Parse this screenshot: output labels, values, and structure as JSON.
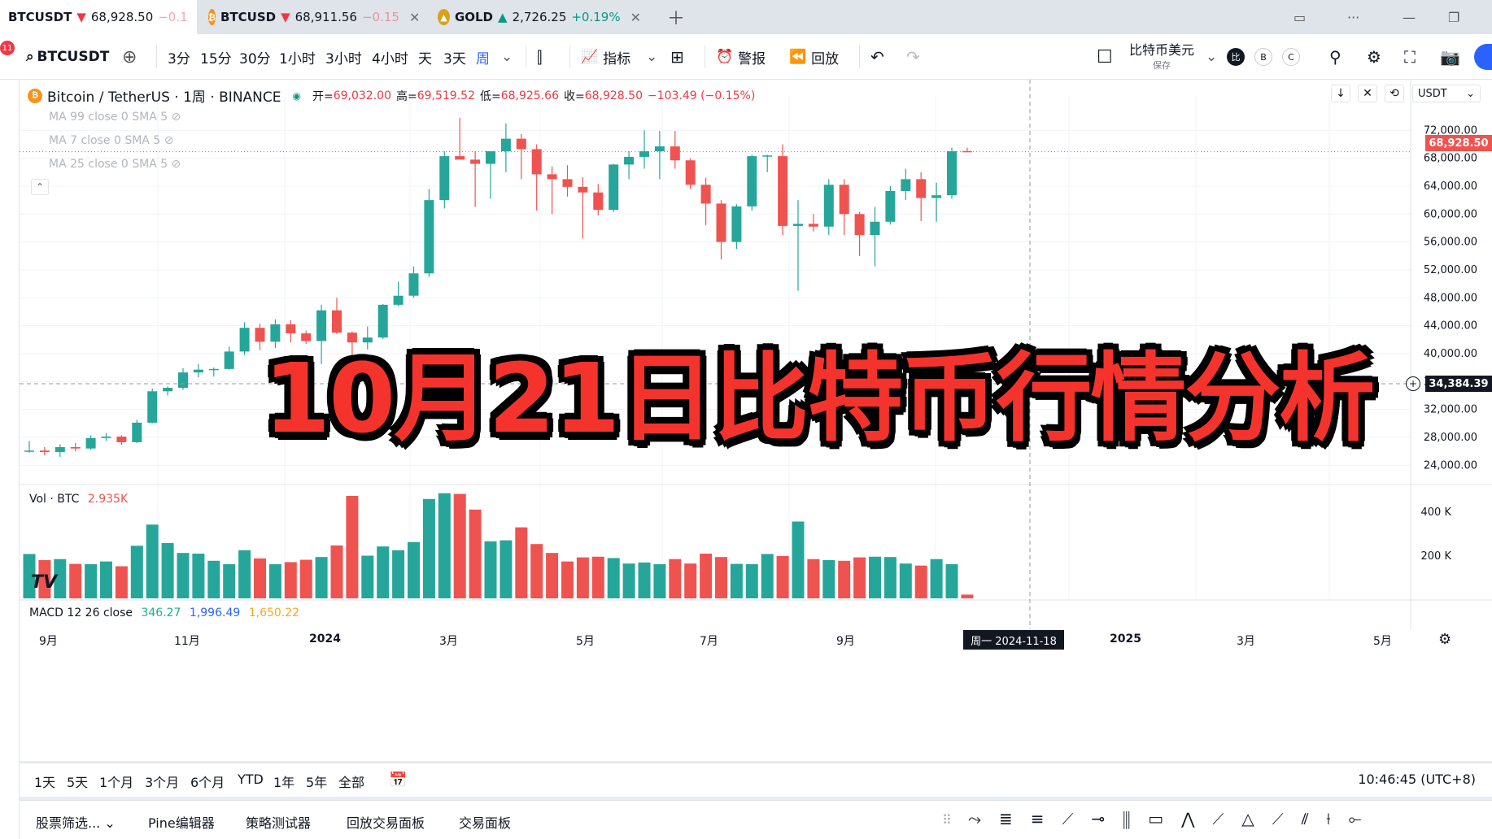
{
  "tabs": [
    {
      "symbol": "BTCUSDT",
      "arrow": "▼",
      "price": "68,928.50",
      "change": "−0.1"
    },
    {
      "symbol": "BTCUSD",
      "arrow": "▼",
      "price": "68,911.56",
      "change": "−0.15"
    },
    {
      "symbol": "GOLD",
      "arrow": "▲",
      "price": "2,726.25",
      "change": "+0.19%"
    }
  ],
  "toolbar": {
    "badge": "11",
    "symbol": "BTCUSDT",
    "intervals": [
      "3分",
      "15分",
      "30分",
      "1小时",
      "3小时",
      "4小时",
      "天",
      "3天",
      "周"
    ],
    "active_interval": "周",
    "indicators": "指标",
    "alert": "警报",
    "replay": "回放",
    "layout_name": "比特币美元",
    "layout_sub": "保存",
    "currency_chips": [
      "比",
      "B",
      "C"
    ]
  },
  "legend": {
    "name": "Bitcoin / TetherUS · 1周 · BINANCE",
    "open_label": "开=",
    "open": "69,032.00",
    "high_label": "高=",
    "high": "69,519.52",
    "low_label": "低=",
    "low": "68,925.66",
    "close_label": "收=",
    "close": "68,928.50",
    "change": "−103.49 (−0.15%)",
    "currency": "USDT"
  },
  "indicators": [
    "MA 99 close 0 SMA 5",
    "MA 7 close 0 SMA 5",
    "MA 25 close 0 SMA 5"
  ],
  "volume": {
    "label": "Vol · BTC",
    "value": "2.935K"
  },
  "macd": {
    "label": "MACD 12 26 close",
    "v1": "346.27",
    "v2": "1,996.49",
    "v3": "1,650.22"
  },
  "overlay_title": "10月21日比特币行情分析",
  "crosshair": {
    "price": "34,384.39",
    "date": "周一 2024-11-18"
  },
  "last_price": "68,928.50",
  "time_axis": [
    "9月",
    "11月",
    "2024",
    "3月",
    "5月",
    "7月",
    "9月",
    "2025",
    "3月",
    "5月"
  ],
  "ranges": [
    "1天",
    "5天",
    "1个月",
    "3个月",
    "6个月",
    "YTD",
    "1年",
    "5年",
    "全部"
  ],
  "clock": "10:46:45 (UTC+8)",
  "bottom_tabs": [
    "股票筛选...",
    "Pine编辑器",
    "策略测试器",
    "回放交易面板",
    "交易面板"
  ],
  "colors": {
    "up": "#26a69a",
    "down": "#ef5350",
    "accent": "#2962ff"
  },
  "chart_data": {
    "type": "candlestick",
    "y_ticks": [
      24000,
      28000,
      32000,
      36000,
      40000,
      44000,
      48000,
      52000,
      56000,
      60000,
      64000,
      68000,
      72000
    ],
    "y_tick_labels": [
      "24,000.00",
      "28,000.00",
      "32,000.00",
      "36,000.00",
      "40,000.00",
      "44,000.00",
      "48,000.00",
      "52,000.00",
      "56,000.00",
      "60,000.00",
      "64,000.00",
      "68,000.00",
      "72,000.00"
    ],
    "ylim": [
      21000,
      76000
    ],
    "candles": [
      [
        26000,
        27500,
        25800,
        26100
      ],
      [
        26100,
        26600,
        25400,
        25900
      ],
      [
        25900,
        27000,
        25200,
        26600
      ],
      [
        26600,
        27200,
        26000,
        26400
      ],
      [
        26400,
        28300,
        26200,
        27900
      ],
      [
        27900,
        28600,
        27500,
        28100
      ],
      [
        28100,
        28300,
        26900,
        27300
      ],
      [
        27300,
        30500,
        27200,
        30100
      ],
      [
        30100,
        35000,
        30000,
        34600
      ],
      [
        34600,
        35300,
        34000,
        35100
      ],
      [
        35100,
        37900,
        34800,
        37300
      ],
      [
        37300,
        38500,
        36600,
        37700
      ],
      [
        37700,
        38000,
        36700,
        37800
      ],
      [
        37800,
        41000,
        37700,
        40300
      ],
      [
        40300,
        44500,
        39800,
        43700
      ],
      [
        43700,
        44300,
        40500,
        41700
      ],
      [
        41700,
        44900,
        40800,
        44200
      ],
      [
        44200,
        44800,
        41600,
        42900
      ],
      [
        42900,
        43300,
        41400,
        41800
      ],
      [
        41800,
        47000,
        38500,
        46200
      ],
      [
        46200,
        48000,
        42800,
        43000
      ],
      [
        43000,
        43200,
        38700,
        41600
      ],
      [
        41600,
        43900,
        40600,
        42300
      ],
      [
        42300,
        47100,
        42100,
        47000
      ],
      [
        47000,
        50300,
        46800,
        48300
      ],
      [
        48300,
        52500,
        48000,
        51500
      ],
      [
        51500,
        63600,
        51000,
        62000
      ],
      [
        62000,
        69000,
        60800,
        68300
      ],
      [
        68300,
        73800,
        67800,
        67800
      ],
      [
        67800,
        69000,
        61000,
        67200
      ],
      [
        67200,
        68800,
        62200,
        69000
      ],
      [
        69000,
        73000,
        66000,
        70800
      ],
      [
        70800,
        71500,
        65000,
        69300
      ],
      [
        69300,
        70000,
        60500,
        65700
      ],
      [
        65700,
        66800,
        60000,
        65000
      ],
      [
        65000,
        67000,
        62500,
        63900
      ],
      [
        63900,
        65300,
        56500,
        63100
      ],
      [
        63100,
        64300,
        59800,
        60600
      ],
      [
        60600,
        67200,
        60300,
        67100
      ],
      [
        67100,
        69000,
        65000,
        68200
      ],
      [
        68200,
        72000,
        66500,
        69000
      ],
      [
        69000,
        71900,
        65000,
        69700
      ],
      [
        69700,
        71900,
        66500,
        67700
      ],
      [
        67700,
        68000,
        63600,
        64200
      ],
      [
        64200,
        65200,
        58400,
        61500
      ],
      [
        61500,
        62000,
        53500,
        56000
      ],
      [
        56000,
        61400,
        55000,
        61100
      ],
      [
        61100,
        68500,
        60500,
        68300
      ],
      [
        68300,
        68500,
        66000,
        68400
      ],
      [
        68300,
        70000,
        57000,
        58300
      ],
      [
        58300,
        62000,
        49000,
        58600
      ],
      [
        58600,
        60000,
        57500,
        58200
      ],
      [
        58200,
        65000,
        57000,
        64200
      ],
      [
        64200,
        65000,
        57000,
        60000
      ],
      [
        60000,
        60300,
        54000,
        57000
      ],
      [
        57000,
        61000,
        52500,
        58900
      ],
      [
        58900,
        64000,
        58500,
        63300
      ],
      [
        63300,
        66500,
        62000,
        65000
      ],
      [
        65000,
        66000,
        59000,
        62300
      ],
      [
        62300,
        64500,
        58900,
        62700
      ],
      [
        62700,
        69500,
        62200,
        69000
      ],
      [
        69032,
        69519.52,
        68925.66,
        68928.5
      ]
    ],
    "volumes": [
      1.3,
      1.12,
      1.15,
      1.01,
      1.0,
      1.08,
      0.94,
      1.54,
      2.16,
      1.62,
      1.33,
      1.31,
      1.1,
      1.0,
      1.41,
      1.17,
      1.0,
      1.06,
      1.13,
      1.21,
      1.55,
      3.0,
      1.25,
      1.52,
      1.41,
      1.65,
      2.91,
      3.08,
      3.06,
      2.6,
      1.67,
      1.7,
      2.08,
      1.59,
      1.33,
      1.08,
      1.2,
      1.22,
      1.18,
      1.02,
      1.05,
      1.0,
      1.15,
      1.02,
      1.31,
      1.21,
      1.01,
      1.0,
      1.3,
      1.24,
      2.25,
      1.15,
      1.12,
      1.1,
      1.2,
      1.22,
      1.21,
      1.02,
      0.96,
      1.15,
      1.0,
      0.11
    ]
  }
}
